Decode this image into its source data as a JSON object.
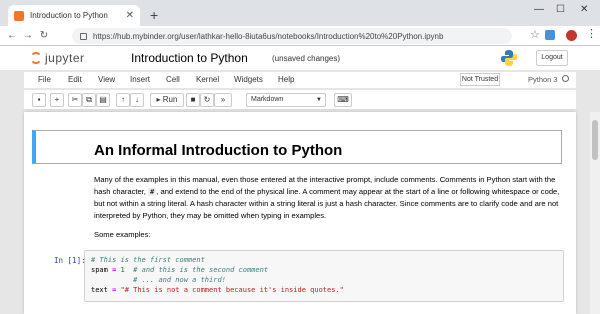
{
  "browser": {
    "tab_title": "Introduction to Python",
    "url": "https://hub.mybinder.org/user/lathkar-hello-8iuta6us/notebooks/Introduction%20to%20Python.ipynb"
  },
  "jupyter": {
    "logo_text": "jupyter",
    "notebook_name": "Introduction to Python",
    "save_status": "(unsaved changes)",
    "logout_label": "Logout",
    "menu": [
      "File",
      "Edit",
      "View",
      "Insert",
      "Cell",
      "Kernel",
      "Widgets",
      "Help"
    ],
    "trust_label": "Not Trusted",
    "kernel_name": "Python 3",
    "toolbar": {
      "run_label": "Run",
      "cell_type": "Markdown"
    }
  },
  "notebook": {
    "heading": "An Informal Introduction to Python",
    "paragraph_part1": "Many of the examples in this manual, even those entered at the interactive prompt, include comments. Comments in Python start with the hash character, ",
    "hash_code": "#",
    "paragraph_part2": ", and extend to the end of the physical line. A comment may appear at the start of a line or following whitespace or code, but not within a string literal. A hash character within a string literal is just a hash character. Since comments are to clarify code and are not interpreted by Python, they may be omitted when typing in examples.",
    "some_examples": "Some examples:",
    "prompt": "In [1]:",
    "code": {
      "line1_comment": "# This is the first comment",
      "line2_var": "spam",
      "line2_op": "=",
      "line2_num": "1",
      "line2_comment": "# and this is the second comment",
      "line3_comment": "# ... and now a third!",
      "line4_var": "text",
      "line4_op": "=",
      "line4_str": "\"# This is not a comment because it's inside quotes.\""
    }
  }
}
